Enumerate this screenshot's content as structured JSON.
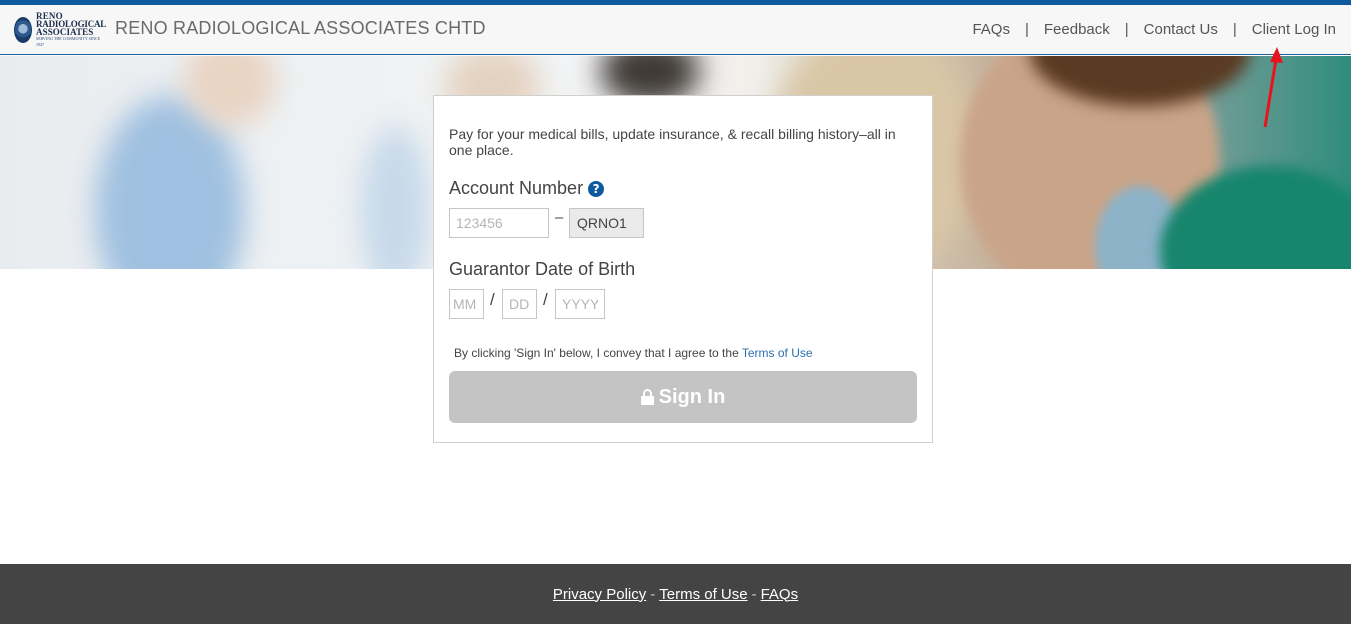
{
  "header": {
    "logo_lines": [
      "RENO",
      "RADIOLOGICAL",
      "ASSOCIATES",
      "SERVING THE COMMUNITY SINCE 1947"
    ],
    "site_title": "RENO RADIOLOGICAL ASSOCIATES CHTD",
    "nav": {
      "faqs": "FAQs",
      "feedback": "Feedback",
      "contact": "Contact Us",
      "client_login": "Client Log In",
      "separator": "|"
    }
  },
  "card": {
    "intro": "Pay for your medical bills, update insurance, & recall billing history–all in one place.",
    "account_label": "Account Number",
    "help_icon": "?",
    "account_placeholder": "123456",
    "account_dash": "–",
    "account_suffix": "QRNO1",
    "dob_label": "Guarantor Date of Birth",
    "mm_placeholder": "MM",
    "dd_placeholder": "DD",
    "yyyy_placeholder": "YYYY",
    "date_separator": "/",
    "terms_prefix": "By clicking 'Sign In' below, I convey that I agree to the",
    "terms_link": "Terms of Use",
    "signin_label": "Sign In"
  },
  "footer": {
    "privacy": "Privacy Policy",
    "terms": "Terms of Use",
    "faqs": "FAQs",
    "separator": "-"
  },
  "colors": {
    "accent": "#0d5a9e",
    "signin_disabled": "#c4c4c4",
    "footer_bg": "#444444",
    "annotation_arrow": "#e8141b"
  }
}
